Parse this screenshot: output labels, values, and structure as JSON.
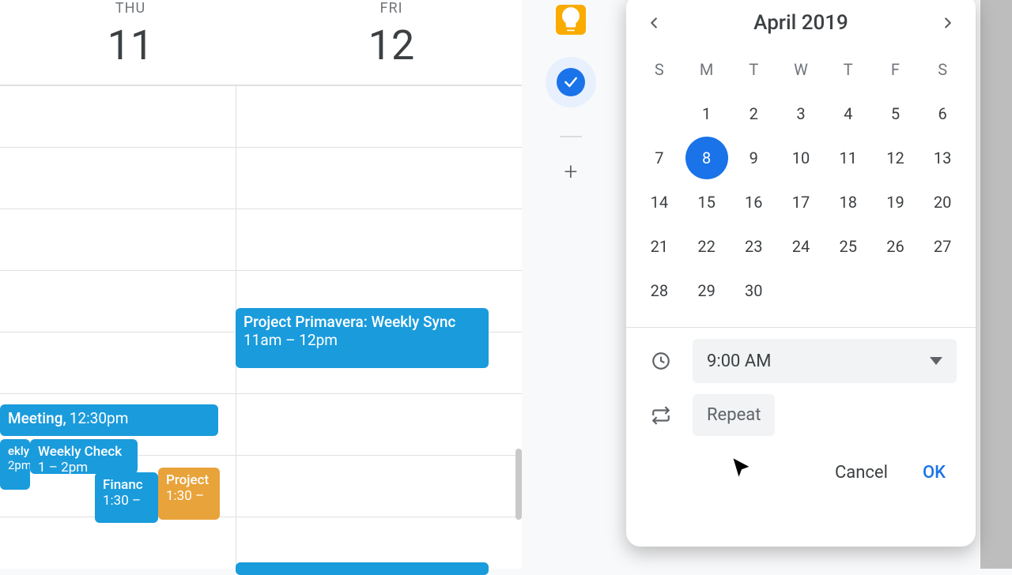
{
  "calendar": {
    "columns": [
      {
        "abbr": "THU",
        "num": "11"
      },
      {
        "abbr": "FRI",
        "num": "12"
      }
    ],
    "events": {
      "primavera": {
        "title": "Project Primavera: Weekly Sync",
        "time": "11am – 12pm"
      },
      "meeting": {
        "title": "Meeting,",
        "time": "12:30pm"
      },
      "wk1": {
        "title": "ekly",
        "time": "2pm"
      },
      "wk2": {
        "title": "Weekly Check",
        "time": "1 – 2pm"
      },
      "fin": {
        "title": "Financ",
        "time": "1:30 –"
      },
      "proj": {
        "title": "Project",
        "time": "1:30 –"
      }
    }
  },
  "sidebar": {
    "keep_icon": "lightbulb-icon",
    "tasks_icon": "tasks-icon",
    "add_icon": "plus-icon"
  },
  "dialog": {
    "month_label": "April 2019",
    "weekdays": [
      "S",
      "M",
      "T",
      "W",
      "T",
      "F",
      "S"
    ],
    "weeks": [
      [
        "",
        "1",
        "2",
        "3",
        "4",
        "5",
        "6"
      ],
      [
        "7",
        "8",
        "9",
        "10",
        "11",
        "12",
        "13"
      ],
      [
        "14",
        "15",
        "16",
        "17",
        "18",
        "19",
        "20"
      ],
      [
        "21",
        "22",
        "23",
        "24",
        "25",
        "26",
        "27"
      ],
      [
        "28",
        "29",
        "30",
        "",
        "",
        "",
        ""
      ]
    ],
    "selected_day": "8",
    "time_value": "9:00 AM",
    "repeat_label": "Repeat",
    "cancel_label": "Cancel",
    "ok_label": "OK"
  },
  "colors": {
    "accent": "#1a73e8",
    "event_blue": "#1a9bdc",
    "event_gold": "#e9a33b"
  }
}
